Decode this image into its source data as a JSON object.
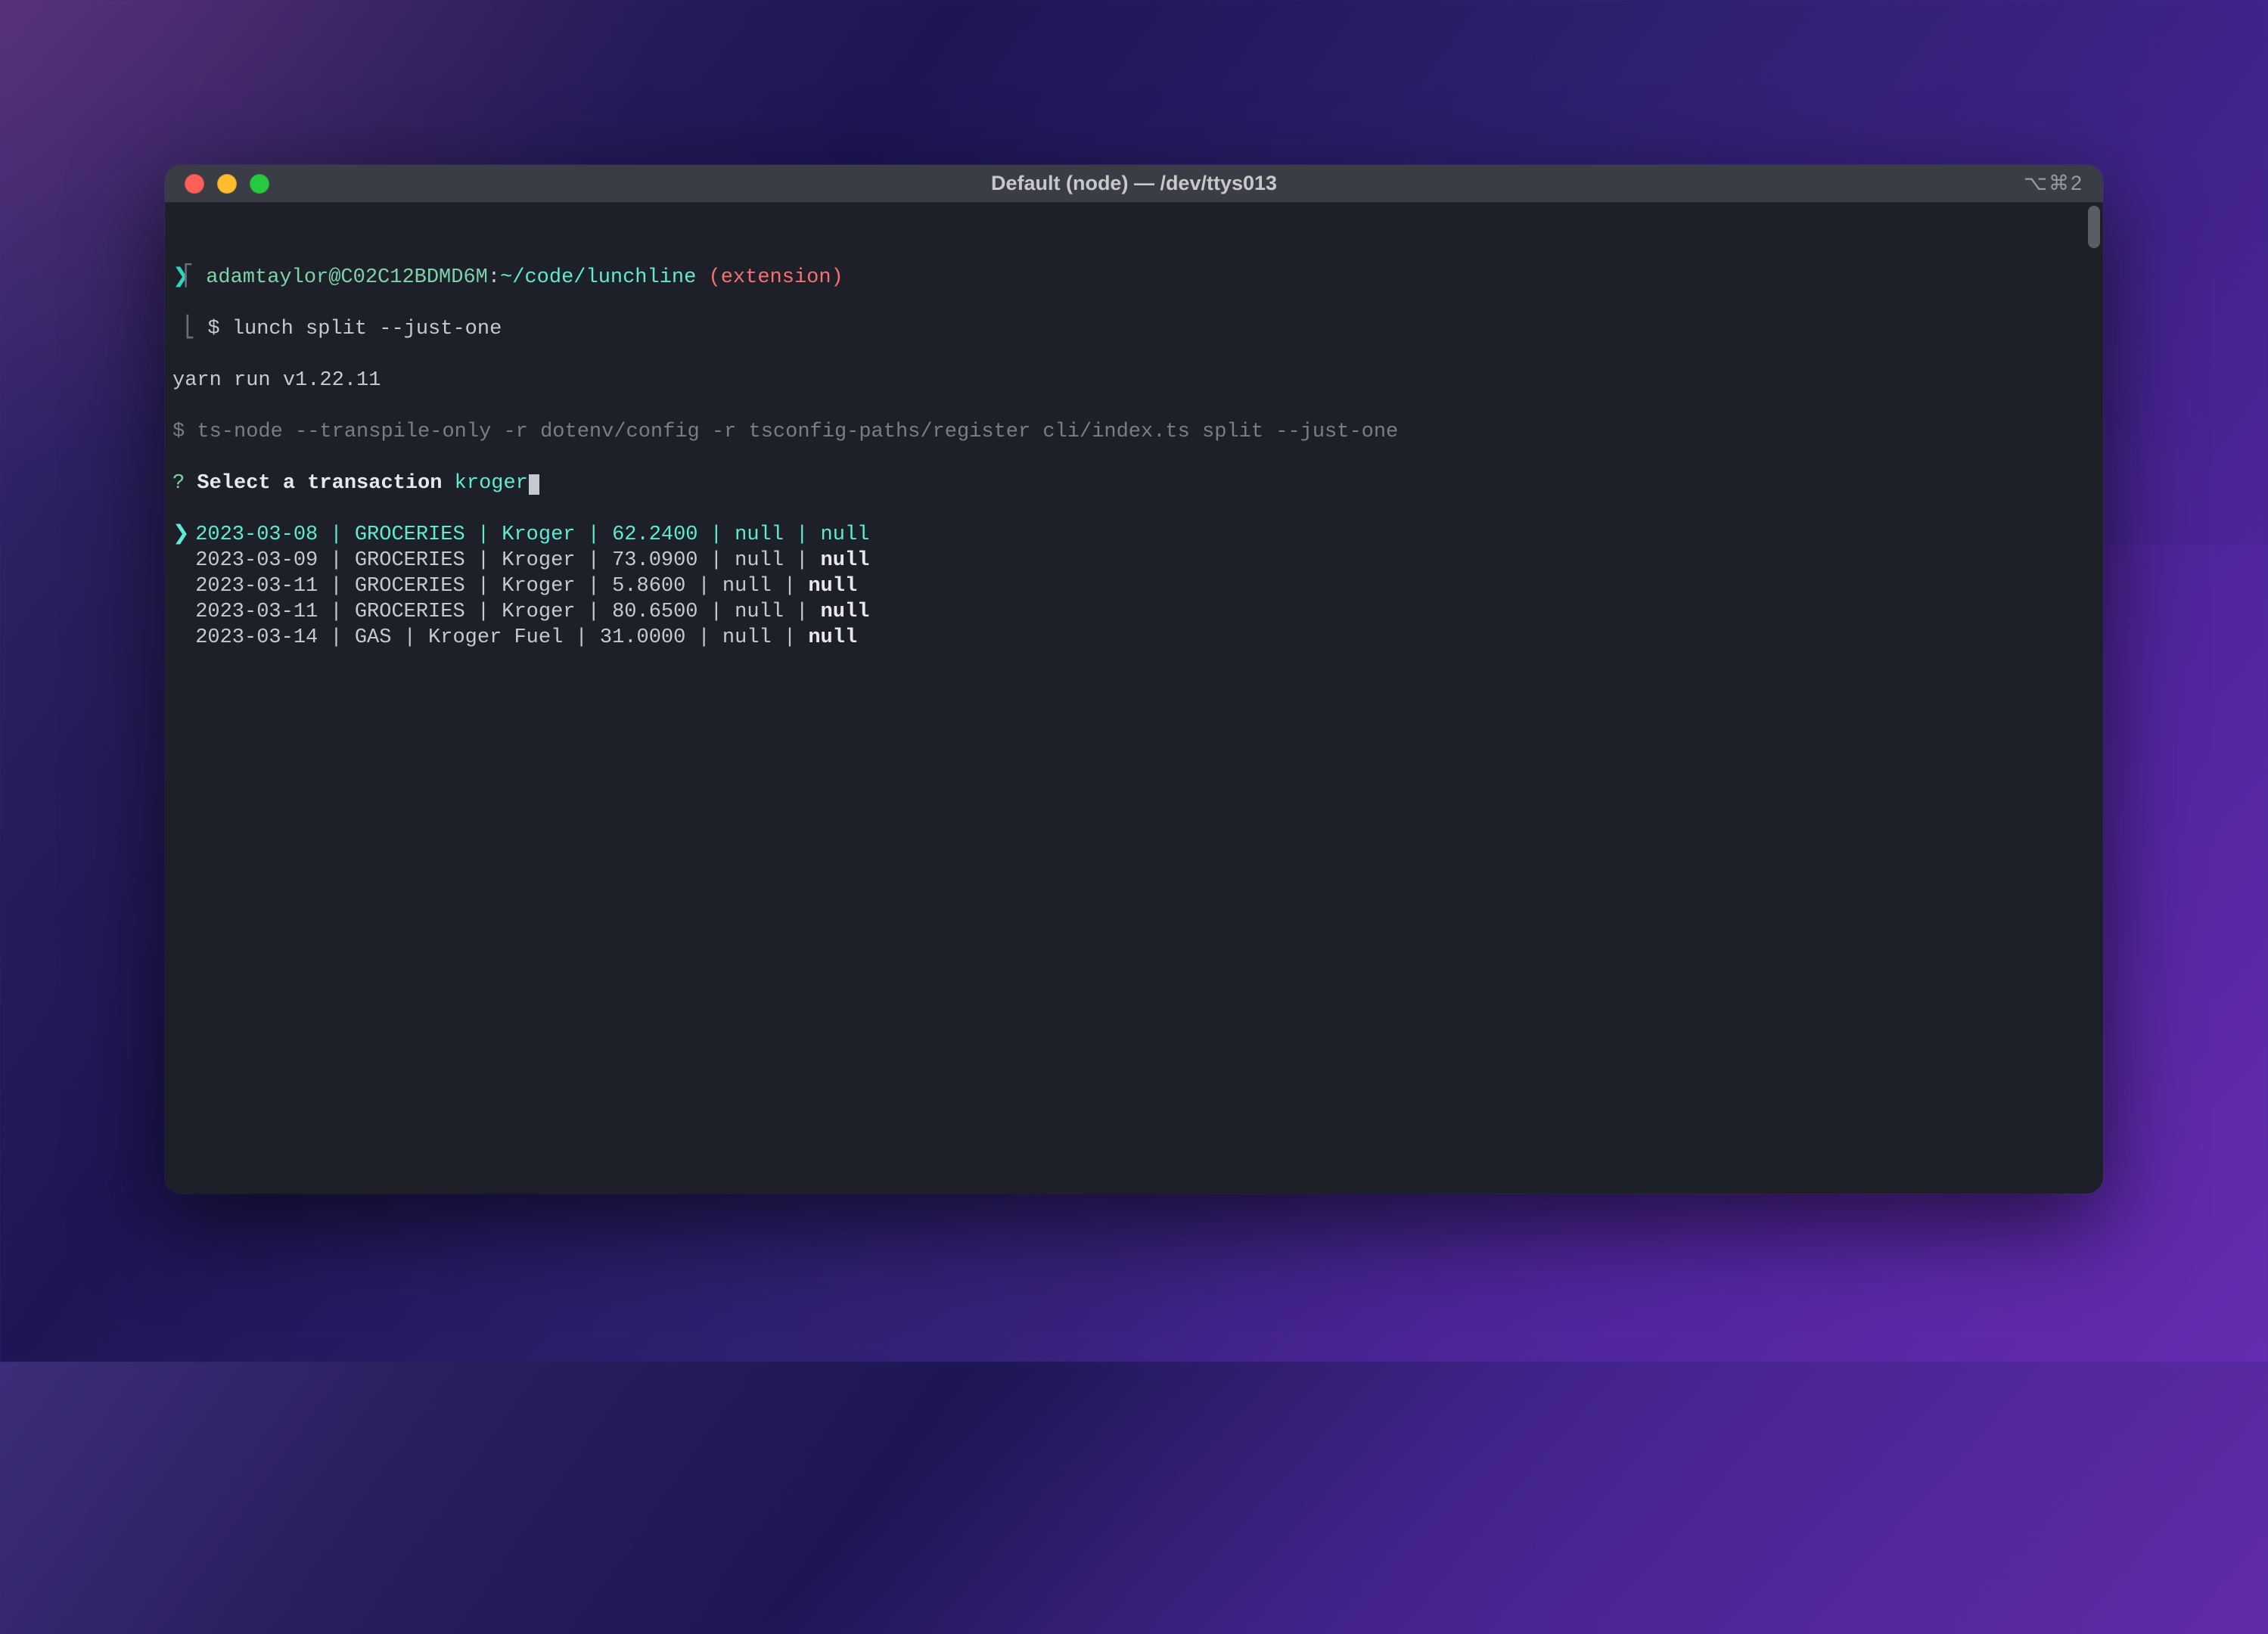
{
  "window": {
    "title": "Default (node) — /dev/ttys013",
    "shortcut": "⌥⌘2"
  },
  "prompt": {
    "caret": "❯",
    "user_host": "adamtaylor@C02C12BDMD6M",
    "separator": ":",
    "cwd": "~/code/lunchline",
    "branch": "(extension)",
    "bracket_open": "⎡",
    "bracket_close": "⎣",
    "command_prefix": "$ ",
    "command": "lunch split --just-one"
  },
  "output": {
    "yarn": "yarn run v1.22.11",
    "ts_prefix": "$ ",
    "ts_command": "ts-node --transpile-only -r dotenv/config -r tsconfig-paths/register cli/index.ts split --just-one"
  },
  "prompt_q": {
    "mark": "?",
    "text": "Select a transaction",
    "input": "kroger"
  },
  "rows": [
    {
      "selected": true,
      "date": "2023-03-08",
      "cat": "GROCERIES",
      "merchant": "Kroger",
      "amount": "62.2400",
      "a": "null",
      "b": "null"
    },
    {
      "selected": false,
      "date": "2023-03-09",
      "cat": "GROCERIES",
      "merchant": "Kroger",
      "amount": "73.0900",
      "a": "null",
      "b": "null"
    },
    {
      "selected": false,
      "date": "2023-03-11",
      "cat": "GROCERIES",
      "merchant": "Kroger",
      "amount": "5.8600",
      "a": "null",
      "b": "null"
    },
    {
      "selected": false,
      "date": "2023-03-11",
      "cat": "GROCERIES",
      "merchant": "Kroger",
      "amount": "80.6500",
      "a": "null",
      "b": "null"
    },
    {
      "selected": false,
      "date": "2023-03-14",
      "cat": "GAS",
      "merchant": "Kroger Fuel",
      "amount": "31.0000",
      "a": "null",
      "b": "null"
    }
  ]
}
